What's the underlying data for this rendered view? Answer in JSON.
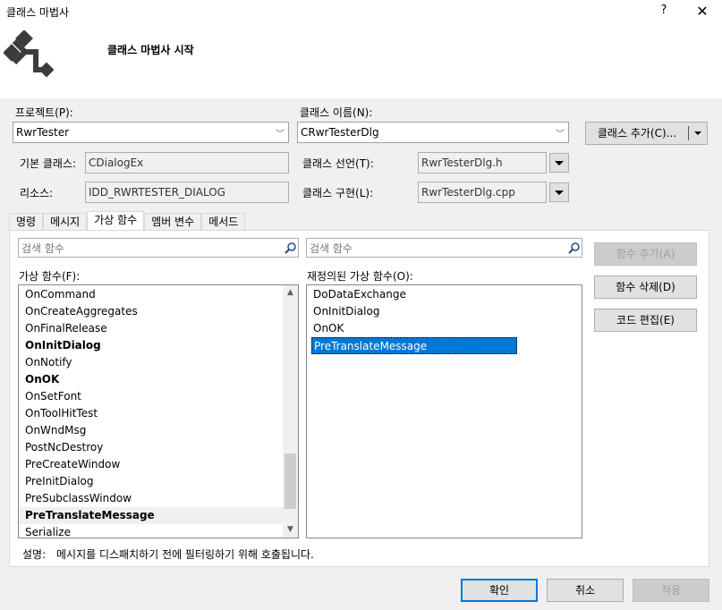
{
  "window": {
    "title": "클래스 마법사",
    "help": "?",
    "close": "✕"
  },
  "banner": {
    "text": "클래스 마법사 시작"
  },
  "project": {
    "label": "프로젝트(P):",
    "value": "RwrTester"
  },
  "class_name": {
    "label": "클래스 이름(N):",
    "value": "CRwrTesterDlg"
  },
  "add_class_button": "클래스 추가(C)...",
  "base_class": {
    "label": "기본 클래스:",
    "value": "CDialogEx"
  },
  "resource": {
    "label": "리소스:",
    "value": "IDD_RWRTESTER_DIALOG"
  },
  "class_decl": {
    "label": "클래스 선언(T):",
    "value": "RwrTesterDlg.h"
  },
  "class_impl": {
    "label": "클래스 구현(L):",
    "value": "RwrTesterDlg.cpp"
  },
  "tabs": [
    "명령",
    "메시지",
    "가상 함수",
    "멤버 변수",
    "메서드"
  ],
  "search_left": {
    "placeholder": "검색 함수"
  },
  "search_right": {
    "placeholder": "검색 함수"
  },
  "virtual_label": "가상 함수(F):",
  "overridden_label": "재정의된 가상 함수(O):",
  "virtual_functions": [
    {
      "name": "OnCommand",
      "bold": false
    },
    {
      "name": "OnCreateAggregates",
      "bold": false
    },
    {
      "name": "OnFinalRelease",
      "bold": false
    },
    {
      "name": "OnInitDialog",
      "bold": true
    },
    {
      "name": "OnNotify",
      "bold": false
    },
    {
      "name": "OnOK",
      "bold": true
    },
    {
      "name": "OnSetFont",
      "bold": false
    },
    {
      "name": "OnToolHitTest",
      "bold": false
    },
    {
      "name": "OnWndMsg",
      "bold": false
    },
    {
      "name": "PostNcDestroy",
      "bold": false
    },
    {
      "name": "PreCreateWindow",
      "bold": false
    },
    {
      "name": "PreInitDialog",
      "bold": false
    },
    {
      "name": "PreSubclassWindow",
      "bold": false
    },
    {
      "name": "PreTranslateMessage",
      "bold": true
    },
    {
      "name": "Serialize",
      "bold": false
    }
  ],
  "overridden_functions": [
    "DoDataExchange",
    "OnInitDialog",
    "OnOK",
    "PreTranslateMessage"
  ],
  "buttons": {
    "add_function": "함수 추가(A)",
    "delete_function": "함수 삭제(D)",
    "edit_code": "코드 편집(E)"
  },
  "description": {
    "label": "설명:",
    "text": "메시지를 디스패치하기 전에 필터링하기 위해 호출됩니다."
  },
  "footer": {
    "ok": "확인",
    "cancel": "취소",
    "apply": "적용"
  },
  "colors": {
    "selection": "#0078d7",
    "focus_border": "#0078d7"
  }
}
